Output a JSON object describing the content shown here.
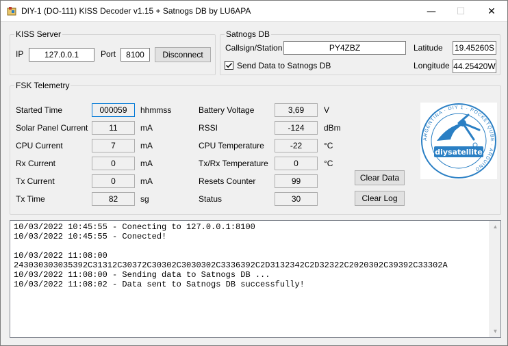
{
  "window": {
    "title": "DIY-1 (DO-111) KISS Decoder v1.15 + Satnogs DB by LU6APA",
    "minimize_glyph": "—",
    "maximize_glyph": "☐",
    "close_glyph": "✕"
  },
  "kiss_server": {
    "legend": "KISS Server",
    "ip_label": "IP",
    "ip_value": "127.0.0.1",
    "port_label": "Port",
    "port_value": "8100",
    "disconnect_label": "Disconnect"
  },
  "satnogs": {
    "legend": "Satnogs DB",
    "callsign_label": "Callsign/Station",
    "callsign_value": "PY4ZBZ",
    "send_label": "Send Data to Satnogs DB",
    "send_checked": true,
    "latitude_label": "Latitude",
    "latitude_value": "19.45260S",
    "longitude_label": "Longitude",
    "longitude_value": "44.25420W"
  },
  "telemetry": {
    "legend": "FSK Telemetry",
    "left": [
      {
        "label": "Started Time",
        "value": "000059",
        "unit": "hhmmss"
      },
      {
        "label": "Solar Panel Current",
        "value": "11",
        "unit": "mA"
      },
      {
        "label": "CPU Current",
        "value": "7",
        "unit": "mA"
      },
      {
        "label": "Rx Current",
        "value": "0",
        "unit": "mA"
      },
      {
        "label": "Tx Current",
        "value": "0",
        "unit": "mA"
      },
      {
        "label": "Tx Time",
        "value": "82",
        "unit": "sg"
      }
    ],
    "right": [
      {
        "label": "Battery Voltage",
        "value": "3,69",
        "unit": "V"
      },
      {
        "label": "RSSI",
        "value": "-124",
        "unit": "dBm"
      },
      {
        "label": "CPU Temperature",
        "value": "-22",
        "unit": "°C"
      },
      {
        "label": "Tx/Rx Temperature",
        "value": "0",
        "unit": "°C"
      },
      {
        "label": "Resets Counter",
        "value": "99",
        "unit": ""
      },
      {
        "label": "Status",
        "value": "30",
        "unit": ""
      }
    ],
    "clear_data_label": "Clear Data",
    "clear_log_label": "Clear Log",
    "logo_text": "diysatellite",
    "logo_ring_text": "ARGENTINA · DIY 1 · POCKETQUBE · ARDUINO"
  },
  "log": {
    "lines": "10/03/2022 10:45:55 - Conecting to 127.0.0.1:8100\n10/03/2022 10:45:55 - Conected!\n\n10/03/2022 11:08:00\n243030303035392C31312C30372C30302C3030302C3336392C2D3132342C2D32322C2020302C39392C33302A\n10/03/2022 11:08:00 - Sending data to Satnogs DB ...\n10/03/2022 11:08:02 - Data sent to Satnogs DB successfully!",
    "scroll_up": "▲",
    "scroll_down": "▼"
  },
  "colors": {
    "logo_blue": "#2a7fc4",
    "focus_border": "#0078d7"
  }
}
